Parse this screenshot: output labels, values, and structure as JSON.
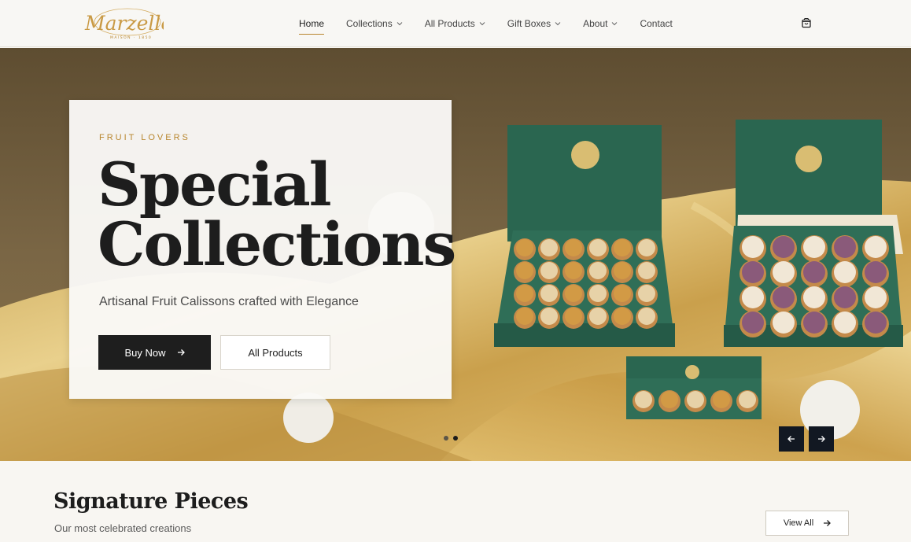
{
  "brand": {
    "name": "Marzelle",
    "tagline": "MAISON · 1850"
  },
  "nav": {
    "items": [
      {
        "label": "Home",
        "active": true,
        "dropdown": false
      },
      {
        "label": "Collections",
        "active": false,
        "dropdown": true
      },
      {
        "label": "All Products",
        "active": false,
        "dropdown": true
      },
      {
        "label": "Gift Boxes",
        "active": false,
        "dropdown": true
      },
      {
        "label": "About",
        "active": false,
        "dropdown": true
      },
      {
        "label": "Contact",
        "active": false,
        "dropdown": false
      }
    ],
    "cart_icon": "shopping-bag-icon"
  },
  "hero": {
    "eyebrow": "FRUIT LOVERS",
    "title_line1": "Special",
    "title_line2": "Collections",
    "subtitle": "Artisanal Fruit Calissons crafted with Elegance",
    "buy_label": "Buy Now",
    "all_products_label": "All Products",
    "slides_count": 2,
    "active_slide": 2,
    "prev_icon": "arrow-left-icon",
    "next_icon": "arrow-right-icon"
  },
  "signature": {
    "title": "Signature Pieces",
    "subtitle": "Our most celebrated creations",
    "view_all_label": "View All"
  },
  "colors": {
    "accent_gold": "#b8862e",
    "dark": "#1e1e1e",
    "box_green": "#2e6b55",
    "background": "#f8f6f2"
  }
}
